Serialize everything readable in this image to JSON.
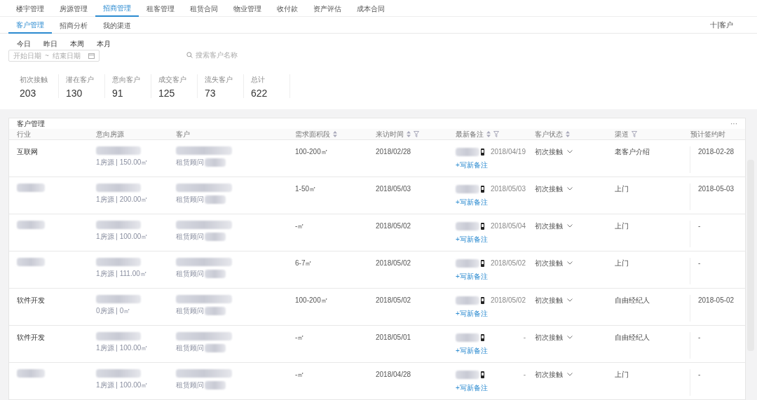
{
  "top_tabs": [
    {
      "label": "楼宇管理",
      "selected": false
    },
    {
      "label": "房源管理",
      "selected": false
    },
    {
      "label": "招商管理",
      "selected": true
    },
    {
      "label": "租客管理",
      "selected": false
    },
    {
      "label": "租赁合同",
      "selected": false
    },
    {
      "label": "物业管理",
      "selected": false
    },
    {
      "label": "收付款",
      "selected": false
    },
    {
      "label": "资产评估",
      "selected": false
    },
    {
      "label": "成本合同",
      "selected": false
    }
  ],
  "sub_tabs": [
    {
      "label": "客户管理",
      "selected": true
    },
    {
      "label": "招商分析",
      "selected": false
    },
    {
      "label": "我的渠道",
      "selected": false
    }
  ],
  "add_button": "十|客户",
  "quick_ranges": [
    "今日",
    "昨日",
    "本周",
    "本月"
  ],
  "date_range": {
    "start_placeholder": "开始日期",
    "separator": "~",
    "end_placeholder": "结束日期"
  },
  "search": {
    "placeholder": "搜索客户名称"
  },
  "stats": [
    {
      "label": "初次接触",
      "value": "203"
    },
    {
      "label": "潜在客户",
      "value": "130"
    },
    {
      "label": "意向客户",
      "value": "91"
    },
    {
      "label": "成交客户",
      "value": "125"
    },
    {
      "label": "流失客户",
      "value": "73"
    },
    {
      "label": "总计",
      "value": "622"
    }
  ],
  "table": {
    "title": "客户管理",
    "more": "···",
    "columns": [
      {
        "label": "行业"
      },
      {
        "label": "意向房源"
      },
      {
        "label": "客户"
      },
      {
        "label": "需求面积段",
        "sortable": true
      },
      {
        "label": "来访时间",
        "sortable": true,
        "filterable": true
      },
      {
        "label": "最新备注",
        "sortable": true,
        "filterable": true
      },
      {
        "label": "客户状态",
        "sortable": true
      },
      {
        "label": "渠道",
        "filterable": true
      },
      {
        "label": "预计签约时"
      }
    ],
    "rows": [
      {
        "industry": "互联网",
        "listing": "1房源 | 150.00㎡",
        "consultant": "租赁顾问",
        "area": "100-200㎡",
        "visit": "2018/02/28",
        "note_date": "2018/04/19",
        "add_note": "+写新备注",
        "status": "初次接触",
        "channel": "老客户介绍",
        "sign_date": "2018-02-28"
      },
      {
        "listing": "1房源 | 200.00㎡",
        "consultant": "租赁顾问",
        "area": "1-50㎡",
        "visit": "2018/05/03",
        "note_date": "2018/05/03",
        "add_note": "+写新备注",
        "status": "初次接触",
        "channel": "上门",
        "sign_date": "2018-05-03"
      },
      {
        "listing": "1房源 | 100.00㎡",
        "consultant": "租赁顾问",
        "area": "-㎡",
        "visit": "2018/05/02",
        "note_date": "2018/05/04",
        "add_note": "+写新备注",
        "status": "初次接触",
        "channel": "上门",
        "sign_date": "-"
      },
      {
        "listing": "1房源 | 111.00㎡",
        "consultant": "租赁顾问",
        "area": "6-7㎡",
        "visit": "2018/05/02",
        "note_date": "2018/05/02",
        "add_note": "+写新备注",
        "status": "初次接触",
        "channel": "上门",
        "sign_date": "-"
      },
      {
        "industry": "软件开发",
        "listing": "0房源 | 0㎡",
        "consultant": "租赁顾问",
        "area": "100-200㎡",
        "visit": "2018/05/02",
        "note_date": "2018/05/02",
        "add_note": "+写新备注",
        "status": "初次接触",
        "channel": "自由经纪人",
        "sign_date": "2018-05-02"
      },
      {
        "industry": "软件开发",
        "listing": "1房源 | 100.00㎡",
        "consultant": "租赁顾问",
        "area": "-㎡",
        "visit": "2018/05/01",
        "note_date": "-",
        "add_note": "+写新备注",
        "status": "初次接触",
        "channel": "自由经纪人",
        "sign_date": "-"
      },
      {
        "listing": "1房源 | 100.00㎡",
        "consultant": "租赁顾问",
        "area": "-㎡",
        "visit": "2018/04/28",
        "note_date": "-",
        "add_note": "+写新备注",
        "status": "初次接触",
        "channel": "上门",
        "sign_date": "-"
      }
    ]
  }
}
